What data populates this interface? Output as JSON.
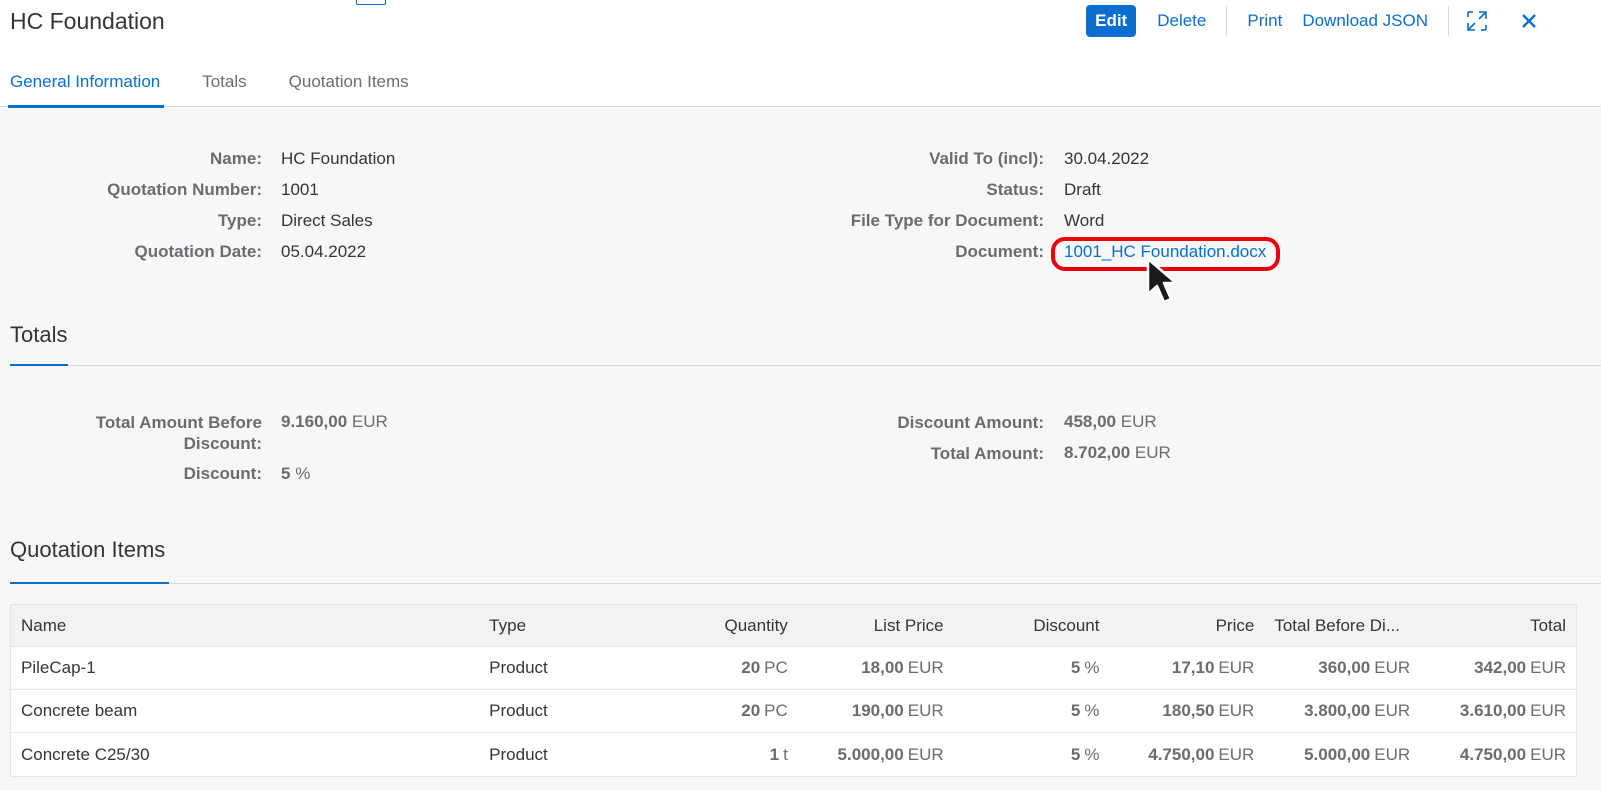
{
  "header": {
    "title": "HC Foundation",
    "actions": {
      "edit": "Edit",
      "delete": "Delete",
      "print": "Print",
      "download_json": "Download JSON"
    },
    "icons": [
      "exit-fullscreen-icon",
      "close-icon"
    ]
  },
  "tabs": [
    {
      "label": "General Information",
      "active": true
    },
    {
      "label": "Totals",
      "active": false
    },
    {
      "label": "Quotation Items",
      "active": false
    }
  ],
  "general": {
    "name_label": "Name:",
    "name": "HC Foundation",
    "quotation_number_label": "Quotation Number:",
    "quotation_number": "1001",
    "type_label": "Type:",
    "type": "Direct Sales",
    "quotation_date_label": "Quotation Date:",
    "quotation_date": "05.04.2022",
    "valid_to_label": "Valid To (incl):",
    "valid_to": "30.04.2022",
    "status_label": "Status:",
    "status": "Draft",
    "file_type_label": "File Type for Document:",
    "file_type": "Word",
    "document_label": "Document:",
    "document": "1001_HC Foundation.docx"
  },
  "totals": {
    "title": "Totals",
    "total_before_discount_label_1": "Total Amount Before",
    "total_before_discount_label_2": "Discount:",
    "total_before_discount": "9.160,00",
    "total_before_discount_unit": "EUR",
    "discount_label": "Discount:",
    "discount": "5",
    "discount_unit": "%",
    "discount_amount_label": "Discount Amount:",
    "discount_amount": "458,00",
    "discount_amount_unit": "EUR",
    "total_amount_label": "Total Amount:",
    "total_amount": "8.702,00",
    "total_amount_unit": "EUR"
  },
  "items": {
    "title": "Quotation Items",
    "columns": [
      "Name",
      "Type",
      "Quantity",
      "List Price",
      "Discount",
      "Price",
      "Total Before Di...",
      "Total"
    ],
    "rows": [
      {
        "name": "PileCap-1",
        "type": "Product",
        "qty": "20",
        "qty_unit": "PC",
        "list_price": "18,00",
        "list_price_unit": "EUR",
        "discount": "5",
        "discount_unit": "%",
        "price": "17,10",
        "price_unit": "EUR",
        "total_before": "360,00",
        "total_before_unit": "EUR",
        "total": "342,00",
        "total_unit": "EUR"
      },
      {
        "name": "Concrete beam",
        "type": "Product",
        "qty": "20",
        "qty_unit": "PC",
        "list_price": "190,00",
        "list_price_unit": "EUR",
        "discount": "5",
        "discount_unit": "%",
        "price": "180,50",
        "price_unit": "EUR",
        "total_before": "3.800,00",
        "total_before_unit": "EUR",
        "total": "3.610,00",
        "total_unit": "EUR"
      },
      {
        "name": "Concrete C25/30",
        "type": "Product",
        "qty": "1",
        "qty_unit": "t",
        "list_price": "5.000,00",
        "list_price_unit": "EUR",
        "discount": "5",
        "discount_unit": "%",
        "price": "4.750,00",
        "price_unit": "EUR",
        "total_before": "5.000,00",
        "total_before_unit": "EUR",
        "total": "4.750,00",
        "total_unit": "EUR"
      }
    ]
  },
  "colors": {
    "brand": "#0a6ed1",
    "highlight": "#e8000b",
    "background": "#f7f7f7"
  }
}
